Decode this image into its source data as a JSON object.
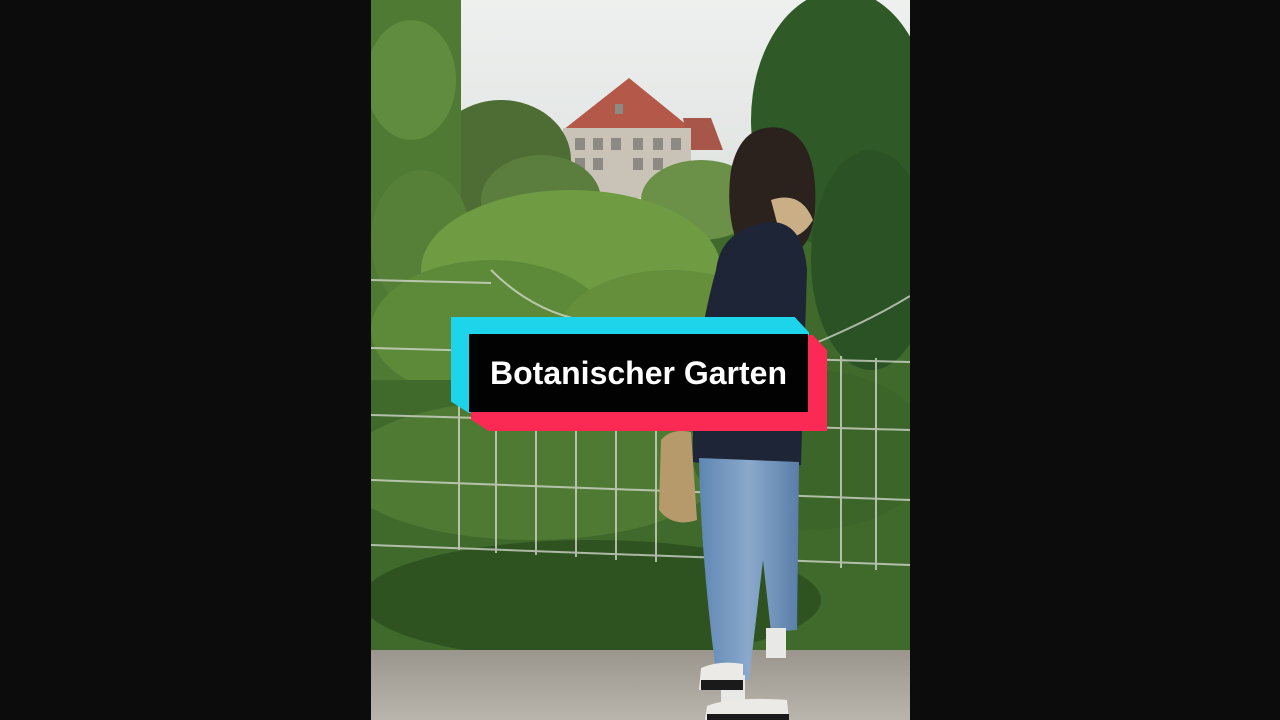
{
  "overlay": {
    "title": "Botanischer Garten"
  },
  "colors": {
    "letterbox": "#0c0c0c",
    "title_box": "#020202",
    "title_text": "#ffffff",
    "accent_cyan": "#1ed4ea",
    "accent_red": "#fb2a55"
  }
}
